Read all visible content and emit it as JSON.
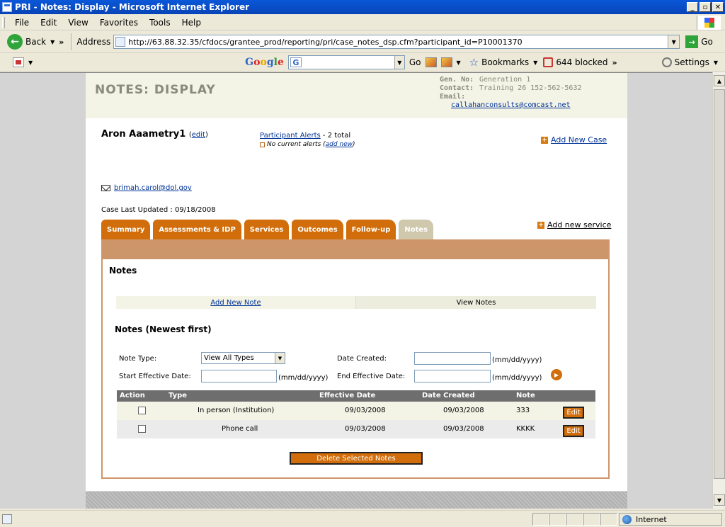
{
  "window": {
    "title": "PRI - Notes: Display - Microsoft Internet Explorer"
  },
  "menu": {
    "items": [
      "File",
      "Edit",
      "View",
      "Favorites",
      "Tools",
      "Help"
    ]
  },
  "address_bar": {
    "back_label": "Back",
    "address_label": "Address",
    "url": "http://63.88.32.35/cfdocs/grantee_prod/reporting/pri/case_notes_dsp.cfm?participant_id=P10001370",
    "go_label": "Go"
  },
  "google_toolbar": {
    "go_label": "Go",
    "bookmarks_label": "Bookmarks",
    "blocked_label": "644 blocked",
    "settings_label": "Settings"
  },
  "page": {
    "title": "NOTES: DISPLAY",
    "info": {
      "gen_key": "Gen. No:",
      "gen_value": "Generation 1",
      "contact_key": "Contact:",
      "contact_value": "Training 26  152-562-5632",
      "email_key": "Email:",
      "email_value": "callahanconsults@comcast.net"
    },
    "participant_name": "Aron Aaametry1",
    "edit_open": "(",
    "edit_label": "edit",
    "edit_close": ")",
    "alerts_link": "Participant Alerts",
    "alerts_total": " - 2 total",
    "no_alerts": "No current alerts ( ",
    "add_new_alert": "add new",
    "no_alerts_close": " )",
    "add_new_case": "Add New Case",
    "user_email": "brimah.carol@dol.gov",
    "case_updated": "Case Last Updated : 09/18/2008",
    "tabs": [
      "Summary",
      "Assessments & IDP",
      "Services",
      "Outcomes",
      "Follow-up",
      "Notes"
    ],
    "add_new_service": "Add new service",
    "panel_heading": "Notes",
    "add_new_note": "Add New Note",
    "view_notes": "View Notes",
    "list_heading": "Notes (Newest first)",
    "filters": {
      "note_type_label": "Note Type:",
      "note_type_value": "View All Types",
      "date_created_label": "Date Created:",
      "start_date_label": "Start Effective Date:",
      "end_date_label": "End Effective Date:",
      "date_hint": "(mm/dd/yyyy)"
    },
    "table": {
      "headers": [
        "Action",
        "Type",
        "Effective Date",
        "Date Created",
        "Note"
      ],
      "rows": [
        {
          "type": "In person (Institution)",
          "effective": "09/03/2008",
          "created": "09/03/2008",
          "note": "333",
          "edit": "Edit"
        },
        {
          "type": "Phone call",
          "effective": "09/03/2008",
          "created": "09/03/2008",
          "note": "KKKK",
          "edit": "Edit"
        }
      ]
    },
    "delete_label": "Delete Selected Notes"
  },
  "status_bar": {
    "zone": "Internet"
  }
}
